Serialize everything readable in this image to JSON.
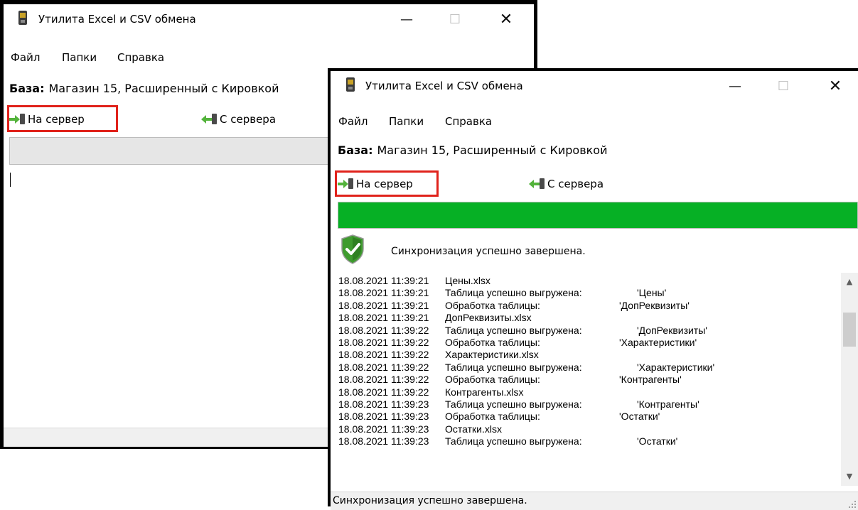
{
  "window_back": {
    "title": "Утилита Excel и CSV обмена",
    "menu": [
      "Файл",
      "Папки",
      "Справка"
    ],
    "base_label": "База:",
    "base_value": "Магазин 15, Расширенный с Кировкой",
    "to_server_label": "На сервер",
    "from_server_label": "С сервера",
    "progress_percent": 0,
    "status_text": ""
  },
  "window_front": {
    "title": "Утилита Excel и CSV обмена",
    "menu": [
      "Файл",
      "Папки",
      "Справка"
    ],
    "base_label": "База:",
    "base_value": "Магазин 15, Расширенный с Кировкой",
    "to_server_label": "На сервер",
    "from_server_label": "С сервера",
    "progress_percent": 100,
    "sync_message": "Синхронизация успешно завершена.",
    "log": [
      {
        "ts": "18.08.2021 11:39:21",
        "msg": "Цены.xlsx",
        "name": ""
      },
      {
        "ts": "18.08.2021 11:39:21",
        "msg": "Таблица успешно выгружена:",
        "name": "'Цены'"
      },
      {
        "ts": "18.08.2021 11:39:21",
        "msg": "Обработка таблицы:",
        "name": "'ДопРеквизиты'"
      },
      {
        "ts": "18.08.2021 11:39:21",
        "msg": "ДопРеквизиты.xlsx",
        "name": ""
      },
      {
        "ts": "18.08.2021 11:39:22",
        "msg": "Таблица успешно выгружена:",
        "name": "'ДопРеквизиты'"
      },
      {
        "ts": "18.08.2021 11:39:22",
        "msg": "Обработка таблицы:",
        "name": "'Характеристики'"
      },
      {
        "ts": "18.08.2021 11:39:22",
        "msg": "Характеристики.xlsx",
        "name": ""
      },
      {
        "ts": "18.08.2021 11:39:22",
        "msg": "Таблица успешно выгружена:",
        "name": "'Характеристики'"
      },
      {
        "ts": "18.08.2021 11:39:22",
        "msg": "Обработка таблицы:",
        "name": "'Контрагенты'"
      },
      {
        "ts": "18.08.2021 11:39:22",
        "msg": "Контрагенты.xlsx",
        "name": ""
      },
      {
        "ts": "18.08.2021 11:39:23",
        "msg": "Таблица успешно выгружена:",
        "name": "'Контрагенты'"
      },
      {
        "ts": "18.08.2021 11:39:23",
        "msg": "Обработка таблицы:",
        "name": "'Остатки'"
      },
      {
        "ts": "18.08.2021 11:39:23",
        "msg": "Остатки.xlsx",
        "name": ""
      },
      {
        "ts": "18.08.2021 11:39:23",
        "msg": "Таблица успешно выгружена:",
        "name": "'Остатки'"
      }
    ],
    "status_text": "Синхронизация успешно завершена."
  },
  "colors": {
    "progress_fill": "#06b025",
    "highlight_box": "#e0221b",
    "arrow_green": "#53b33b"
  },
  "icons": {
    "app": "mobile-device-icon",
    "to_server": "arrow-right-device-icon",
    "from_server": "arrow-left-device-icon",
    "success": "green-shield-check-icon"
  }
}
